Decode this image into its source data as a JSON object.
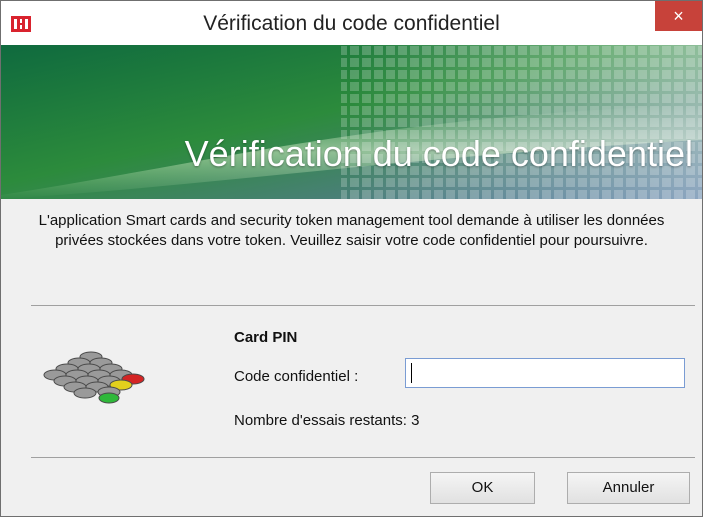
{
  "window": {
    "title": "Vérification du code confidentiel",
    "close_label": "×"
  },
  "banner": {
    "title": "Vérification du code confidentiel"
  },
  "message": "L'application Smart cards and security token management tool demande à utiliser les données privées stockées dans votre token. Veuillez saisir votre code confidentiel pour poursuivre.",
  "pin_section": {
    "heading": "Card PIN",
    "field_label": "Code confidentiel :",
    "field_value": "",
    "attempts_text": "Nombre d'essais restants: 3"
  },
  "buttons": {
    "ok_label": "OK",
    "cancel_label": "Annuler"
  },
  "colors": {
    "close_button": "#c7423a",
    "app_icon": "#d9232e",
    "banner_green": "#2e8b3a",
    "banner_blue": "#3b5f8f"
  },
  "icons": {
    "app": "app-logo-icon",
    "close": "close-icon",
    "token": "smart-token-icon"
  }
}
